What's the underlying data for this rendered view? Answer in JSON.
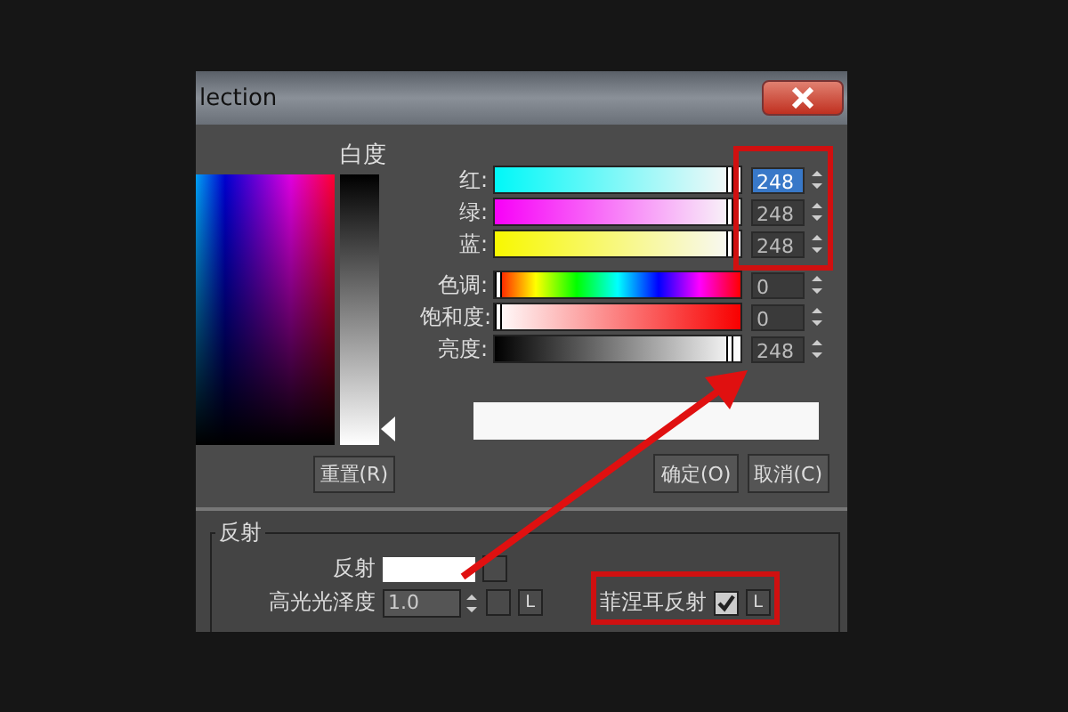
{
  "window": {
    "title": "lection"
  },
  "whiteness_label": "白度",
  "sliders": [
    {
      "kind": "r",
      "label": "红:",
      "value": "248",
      "level": 0.97,
      "selected": true
    },
    {
      "kind": "g",
      "label": "绿:",
      "value": "248",
      "level": 0.97,
      "selected": false
    },
    {
      "kind": "b",
      "label": "蓝:",
      "value": "248",
      "level": 0.97,
      "selected": false
    },
    {
      "kind": "hue",
      "label": "色调:",
      "value": "0",
      "level": 0,
      "selected": false
    },
    {
      "kind": "sat",
      "label": "饱和度:",
      "value": "0",
      "level": 0,
      "selected": false
    },
    {
      "kind": "val",
      "label": "亮度:",
      "value": "248",
      "level": 0.97,
      "selected": false
    }
  ],
  "buttons": {
    "reset": "重置(R)",
    "ok": "确定(O)",
    "cancel": "取消(C)"
  },
  "material": {
    "group": "反射",
    "reflection_label": "反射",
    "gloss_label": "高光光泽度",
    "gloss_value": "1.0",
    "gloss_lock": "L",
    "fresnel_label": "菲涅耳反射",
    "fresnel_checked": true,
    "fresnel_lock": "L"
  }
}
